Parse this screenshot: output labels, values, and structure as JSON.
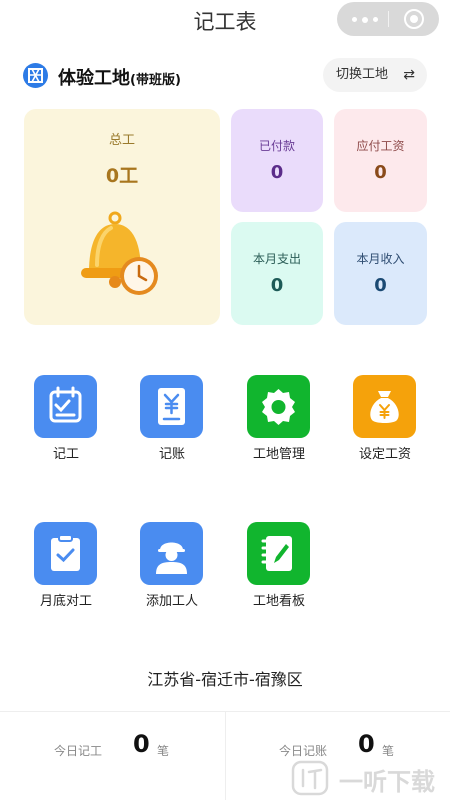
{
  "nav": {
    "title": "记工表"
  },
  "site": {
    "name": "体验工地",
    "tag": "(带班版)",
    "switch_label": "切换工地",
    "switch_icon": "⇄"
  },
  "summary": {
    "total": {
      "label": "总工",
      "value": "0工"
    },
    "paid": {
      "label": "已付款",
      "value": "0"
    },
    "due": {
      "label": "应付工资",
      "value": "0"
    },
    "month_expense": {
      "label": "本月支出",
      "value": "0"
    },
    "month_income": {
      "label": "本月收入",
      "value": "0"
    }
  },
  "actions": [
    {
      "label": "记工",
      "icon": "calendar-check-icon",
      "color": "#4a8cf0"
    },
    {
      "label": "记账",
      "icon": "yuan-receipt-icon",
      "color": "#4a8cf0"
    },
    {
      "label": "工地管理",
      "icon": "gear-icon",
      "color": "#11b52e"
    },
    {
      "label": "设定工资",
      "icon": "money-bag-icon",
      "color": "#f5a20b"
    },
    {
      "label": "月底对工",
      "icon": "clipboard-check-icon",
      "color": "#4a8cf0"
    },
    {
      "label": "添加工人",
      "icon": "worker-icon",
      "color": "#4a8cf0"
    },
    {
      "label": "工地看板",
      "icon": "notebook-pen-icon",
      "color": "#11b52e"
    }
  ],
  "location": "江苏省-宿迁市-宿豫区",
  "today": {
    "work": {
      "label": "今日记工",
      "value": "0",
      "unit": "笔"
    },
    "account": {
      "label": "今日记账",
      "value": "0",
      "unit": "笔"
    }
  },
  "watermark": "一听下载"
}
